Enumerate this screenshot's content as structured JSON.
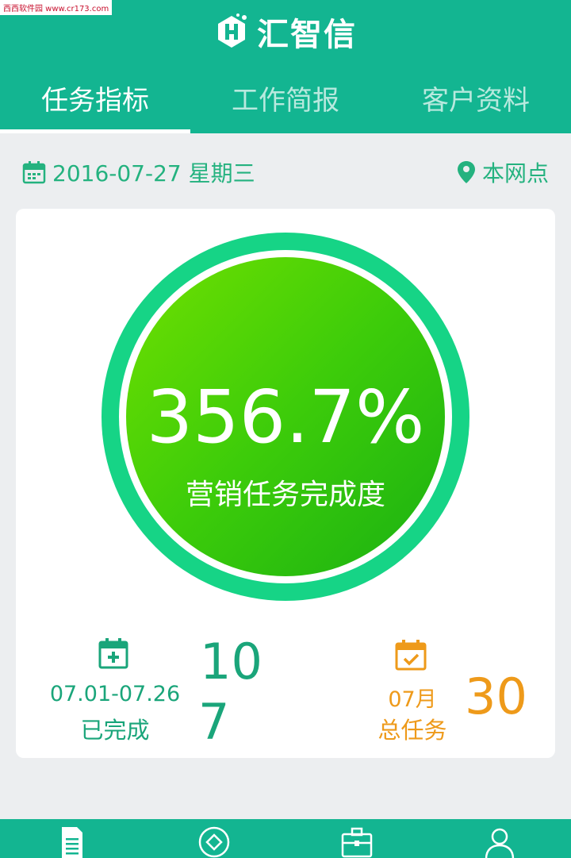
{
  "watermark": "西西软件园 www.cr173.com",
  "app": {
    "brand_name": "汇智信"
  },
  "tabs": [
    {
      "label": "任务指标",
      "active": true
    },
    {
      "label": "工作简报",
      "active": false
    },
    {
      "label": "客户资料",
      "active": false
    }
  ],
  "info": {
    "date": "2016-07-27 星期三",
    "location": "本网点"
  },
  "gauge": {
    "value": "356.7%",
    "label": "营销任务完成度"
  },
  "completed": {
    "range": "07.01-07.26",
    "label": "已完成",
    "value_line1": "10",
    "value_line2": "7"
  },
  "total": {
    "month": "07月",
    "label": "总任务",
    "value": "30"
  },
  "bottom_nav": {
    "items": [
      {
        "icon": "document-icon"
      },
      {
        "icon": "diamond-icon"
      },
      {
        "icon": "briefcase-icon"
      },
      {
        "icon": "user-icon"
      }
    ]
  },
  "colors": {
    "primary": "#13b591",
    "text_green": "#1aa57a",
    "ring": "#16d486",
    "orange": "#ee9a1a",
    "gauge_start": "#70e000",
    "gauge_end": "#1ab112"
  }
}
